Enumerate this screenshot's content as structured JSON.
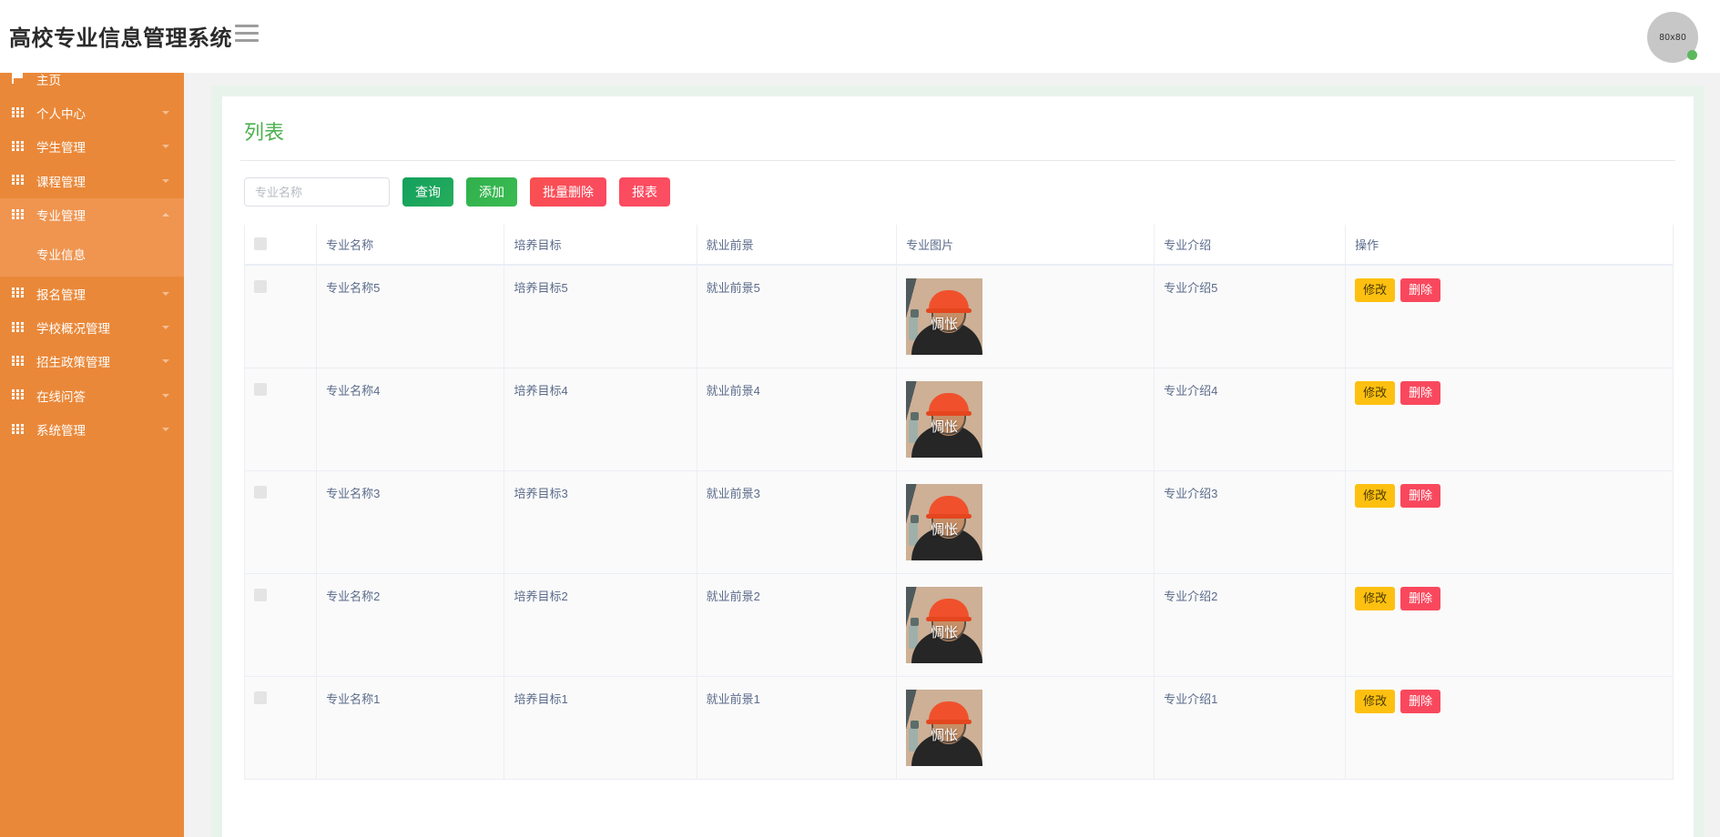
{
  "header": {
    "title": "高校专业信息管理系统",
    "menu_icon": "hamburger-icon",
    "avatar_label": "80x80",
    "status": "online"
  },
  "sidebar": {
    "background_color": "#ea8839",
    "active_color": "#ef9550",
    "items": [
      {
        "label": "主页",
        "icon": "flag-icon",
        "expandable": false,
        "active": false
      },
      {
        "label": "个人中心",
        "icon": "grid-icon",
        "expandable": true,
        "active": false
      },
      {
        "label": "学生管理",
        "icon": "grid-icon",
        "expandable": true,
        "active": false
      },
      {
        "label": "课程管理",
        "icon": "grid-icon",
        "expandable": true,
        "active": false
      },
      {
        "label": "专业管理",
        "icon": "grid-icon",
        "expandable": true,
        "active": true
      },
      {
        "label": "报名管理",
        "icon": "grid-icon",
        "expandable": true,
        "active": false
      },
      {
        "label": "学校概况管理",
        "icon": "grid-icon",
        "expandable": true,
        "active": false
      },
      {
        "label": "招生政策管理",
        "icon": "grid-icon",
        "expandable": true,
        "active": false
      },
      {
        "label": "在线问答",
        "icon": "grid-icon",
        "expandable": true,
        "active": false
      },
      {
        "label": "系统管理",
        "icon": "grid-icon",
        "expandable": true,
        "active": false
      }
    ],
    "sub_items": [
      {
        "label": "专业信息",
        "parent": "专业管理",
        "active": true
      }
    ]
  },
  "panel": {
    "title": "列表",
    "title_color": "#4cb050"
  },
  "toolbar": {
    "search_placeholder": "专业名称",
    "search_value": "",
    "query_label": "查询",
    "add_label": "添加",
    "batch_delete_label": "批量删除",
    "report_label": "报表",
    "colors": {
      "query": "#12a05d",
      "add": "#3cbc52",
      "batch_delete": "#f9504f",
      "report": "#fb4a5f"
    }
  },
  "table": {
    "columns": [
      "",
      "专业名称",
      "培养目标",
      "就业前景",
      "专业图片",
      "专业介绍",
      "操作"
    ],
    "select_all_checked": false,
    "row_actions": {
      "edit_label": "修改",
      "delete_label": "删除",
      "edit_color": "#fdc010",
      "delete_color": "#f9485d"
    },
    "image_overlay_text": "惆怅",
    "rows": [
      {
        "checked": false,
        "name": "专业名称5",
        "goal": "培养目标5",
        "prospect": "就业前景5",
        "image_alt": "专业图片5",
        "intro": "专业介绍5"
      },
      {
        "checked": false,
        "name": "专业名称4",
        "goal": "培养目标4",
        "prospect": "就业前景4",
        "image_alt": "专业图片4",
        "intro": "专业介绍4"
      },
      {
        "checked": false,
        "name": "专业名称3",
        "goal": "培养目标3",
        "prospect": "就业前景3",
        "image_alt": "专业图片3",
        "intro": "专业介绍3"
      },
      {
        "checked": false,
        "name": "专业名称2",
        "goal": "培养目标2",
        "prospect": "就业前景2",
        "image_alt": "专业图片2",
        "intro": "专业介绍2"
      },
      {
        "checked": false,
        "name": "专业名称1",
        "goal": "培养目标1",
        "prospect": "就业前景1",
        "image_alt": "专业图片1",
        "intro": "专业介绍1"
      }
    ]
  }
}
